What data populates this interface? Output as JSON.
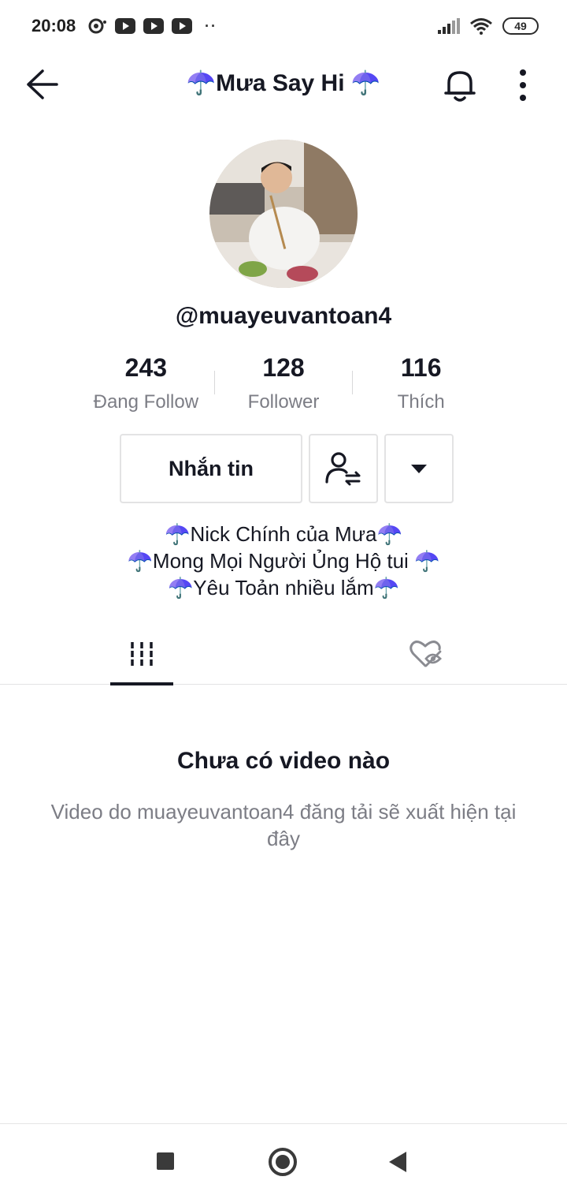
{
  "status_bar": {
    "time": "20:08",
    "battery": "49"
  },
  "header": {
    "title": "☂️Mưa Say Hi ☂️"
  },
  "profile": {
    "username": "@muayeuvantoan4",
    "stats": [
      {
        "value": "243",
        "label": "Đang Follow"
      },
      {
        "value": "128",
        "label": "Follower"
      },
      {
        "value": "116",
        "label": "Thích"
      }
    ],
    "message_button": "Nhắn tin",
    "bio_lines": [
      "☂️Nick Chính của Mưa☂️",
      "☂️Mong Mọi Người Ủng Hộ tui ☂️",
      "☂️Yêu Toản nhiều lắm☂️"
    ]
  },
  "empty_state": {
    "title": "Chưa có video nào",
    "subtitle": "Video do muayeuvantoan4 đăng tải sẽ xuất hiện tại đây"
  },
  "colors": {
    "text_primary": "#161823",
    "text_secondary": "#7c7d85",
    "border": "#e3e3e4"
  }
}
